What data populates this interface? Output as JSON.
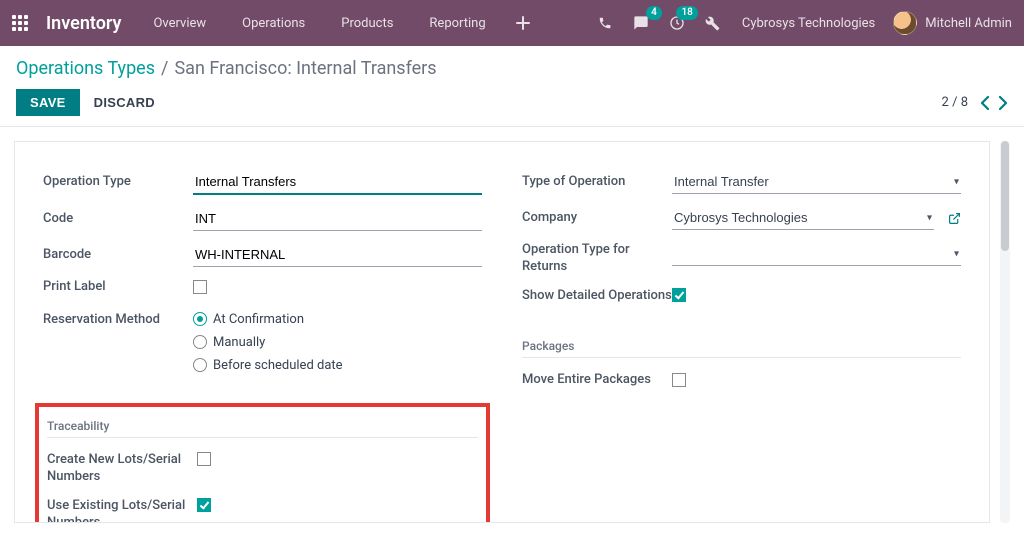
{
  "navbar": {
    "app_title": "Inventory",
    "menu": [
      "Overview",
      "Operations",
      "Products",
      "Reporting"
    ],
    "badges": {
      "messages": "4",
      "activities": "18"
    },
    "company": "Cybrosys Technologies",
    "user_name": "Mitchell Admin"
  },
  "breadcrumb": {
    "root": "Operations Types",
    "current": "San Francisco: Internal Transfers"
  },
  "toolbar": {
    "save_label": "SAVE",
    "discard_label": "DISCARD",
    "pager_pos": "2",
    "pager_total": "8"
  },
  "left": {
    "operation_type_label": "Operation Type",
    "operation_type_value": "Internal Transfers",
    "code_label": "Code",
    "code_value": "INT",
    "barcode_label": "Barcode",
    "barcode_value": "WH-INTERNAL",
    "print_label_label": "Print Label",
    "reservation_label": "Reservation Method",
    "reservation_options": {
      "at_confirmation": "At Confirmation",
      "manually": "Manually",
      "before_scheduled": "Before scheduled date"
    },
    "traceability_header": "Traceability",
    "create_lots_label": "Create New Lots/Serial Numbers",
    "use_existing_label": "Use Existing Lots/Serial Numbers"
  },
  "right": {
    "type_op_label": "Type of Operation",
    "type_op_value": "Internal Transfer",
    "company_label": "Company",
    "company_value": "Cybrosys Technologies",
    "returns_label": "Operation Type for Returns",
    "returns_value": "",
    "show_detailed_label": "Show Detailed Operations",
    "packages_header": "Packages",
    "move_entire_label": "Move Entire Packages"
  }
}
